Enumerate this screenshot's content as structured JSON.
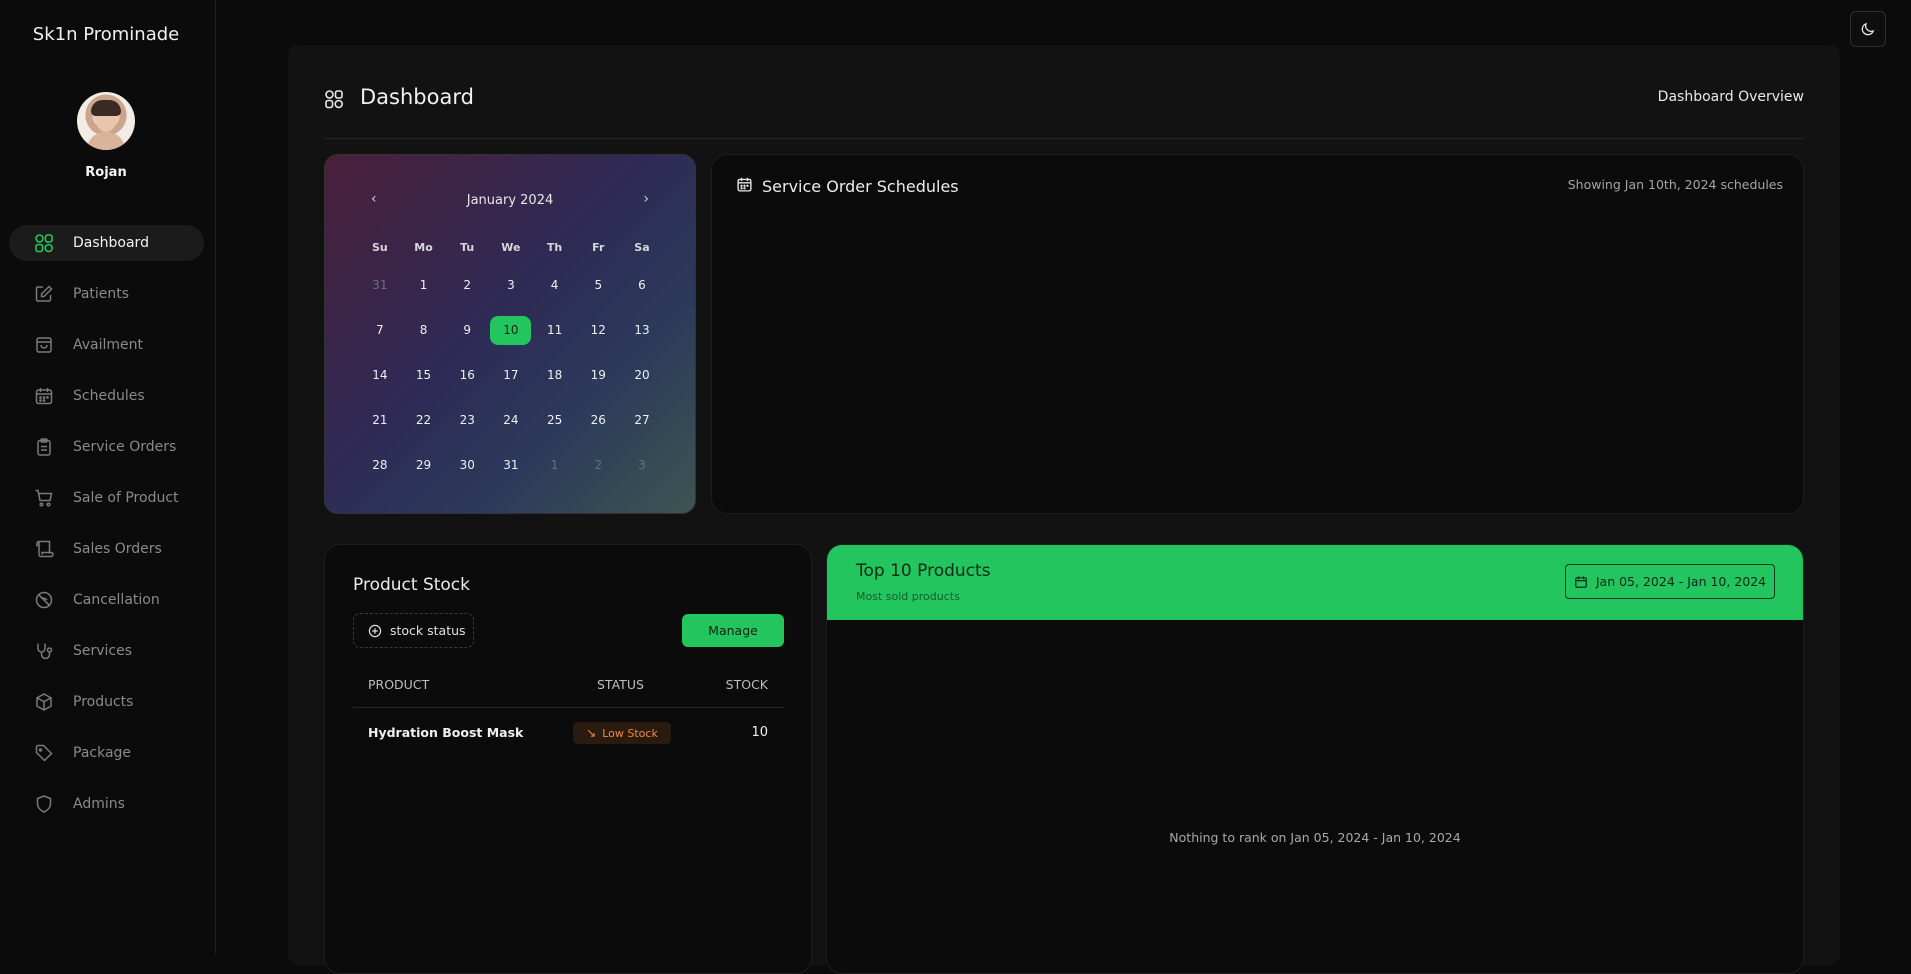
{
  "brand": "Sk1n Prominade",
  "user": {
    "name": "Rojan"
  },
  "nav": [
    {
      "label": "Dashboard",
      "icon": "dashboard-icon",
      "active": true
    },
    {
      "label": "Patients",
      "icon": "edit-icon"
    },
    {
      "label": "Availment",
      "icon": "shopping-bag-icon"
    },
    {
      "label": "Schedules",
      "icon": "calendar-icon"
    },
    {
      "label": "Service Orders",
      "icon": "clipboard-icon"
    },
    {
      "label": "Sale of Product",
      "icon": "cart-icon"
    },
    {
      "label": "Sales Orders",
      "icon": "scroll-icon"
    },
    {
      "label": "Cancellation",
      "icon": "cancel-icon"
    },
    {
      "label": "Services",
      "icon": "stethoscope-icon"
    },
    {
      "label": "Products",
      "icon": "box-icon"
    },
    {
      "label": "Package",
      "icon": "tag-icon"
    },
    {
      "label": "Admins",
      "icon": "shield-icon"
    }
  ],
  "header": {
    "title": "Dashboard",
    "right": "Dashboard Overview"
  },
  "calendar": {
    "month": "January 2024",
    "prev": "‹",
    "next": "›",
    "weekdays": [
      "Su",
      "Mo",
      "Tu",
      "We",
      "Th",
      "Fr",
      "Sa"
    ],
    "days": [
      {
        "d": "31",
        "m": true
      },
      {
        "d": "1"
      },
      {
        "d": "2"
      },
      {
        "d": "3"
      },
      {
        "d": "4"
      },
      {
        "d": "5"
      },
      {
        "d": "6"
      },
      {
        "d": "7"
      },
      {
        "d": "8"
      },
      {
        "d": "9"
      },
      {
        "d": "10",
        "sel": true
      },
      {
        "d": "11"
      },
      {
        "d": "12"
      },
      {
        "d": "13"
      },
      {
        "d": "14"
      },
      {
        "d": "15"
      },
      {
        "d": "16"
      },
      {
        "d": "17"
      },
      {
        "d": "18"
      },
      {
        "d": "19"
      },
      {
        "d": "20"
      },
      {
        "d": "21"
      },
      {
        "d": "22"
      },
      {
        "d": "23"
      },
      {
        "d": "24"
      },
      {
        "d": "25"
      },
      {
        "d": "26"
      },
      {
        "d": "27"
      },
      {
        "d": "28"
      },
      {
        "d": "29"
      },
      {
        "d": "30"
      },
      {
        "d": "31"
      },
      {
        "d": "1",
        "m": true
      },
      {
        "d": "2",
        "m": true
      },
      {
        "d": "3",
        "m": true
      }
    ]
  },
  "schedules": {
    "title": "Service Order Schedules",
    "subtitle": "Showing Jan 10th, 2024 schedules"
  },
  "stock": {
    "title": "Product Stock",
    "filter_label": "stock status",
    "manage_label": "Manage",
    "columns": {
      "product": "PRODUCT",
      "status": "STATUS",
      "stock": "STOCK"
    },
    "rows": [
      {
        "product": "Hydration Boost Mask",
        "status": "Low Stock",
        "stock": "10"
      }
    ]
  },
  "top10": {
    "title": "Top 10 Products",
    "subtitle": "Most sold products",
    "range": "Jan 05, 2024 - Jan 10, 2024",
    "empty": "Nothing to rank on Jan 05, 2024 - Jan 10, 2024"
  },
  "colors": {
    "accent": "#22c55e",
    "warning": "#f08a3c"
  }
}
